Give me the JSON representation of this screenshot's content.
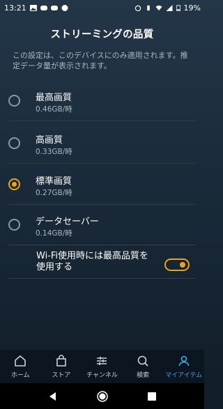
{
  "status_bar": {
    "time": "13:21",
    "battery": "19%"
  },
  "header": {
    "title": "ストリーミングの品質"
  },
  "description": "この設定は、このデバイスにのみ適用されます。推定データ量が表示されます。",
  "options": [
    {
      "label": "最高画質",
      "data_rate": "0.46GB/時",
      "selected": false
    },
    {
      "label": "高画質",
      "data_rate": "0.33GB/時",
      "selected": false
    },
    {
      "label": "標準画質",
      "data_rate": "0.27GB/時",
      "selected": true
    },
    {
      "label": "データセーバー",
      "data_rate": "0.14GB/時",
      "selected": false
    }
  ],
  "wifi_toggle": {
    "label": "Wi-Fi使用時には最高品質を使用する",
    "enabled": true
  },
  "bottom_nav": {
    "items": [
      {
        "label": "ホーム",
        "icon": "home-icon",
        "active": false
      },
      {
        "label": "ストア",
        "icon": "store-bag-icon",
        "active": false
      },
      {
        "label": "チャンネル",
        "icon": "channels-icon",
        "active": false
      },
      {
        "label": "検索",
        "icon": "search-icon",
        "active": false
      },
      {
        "label": "マイアイテム",
        "icon": "profile-icon",
        "active": true
      }
    ]
  },
  "colors": {
    "accent": "#f0a020",
    "active_nav": "#3fa9e6",
    "background": "#1a2a39"
  }
}
